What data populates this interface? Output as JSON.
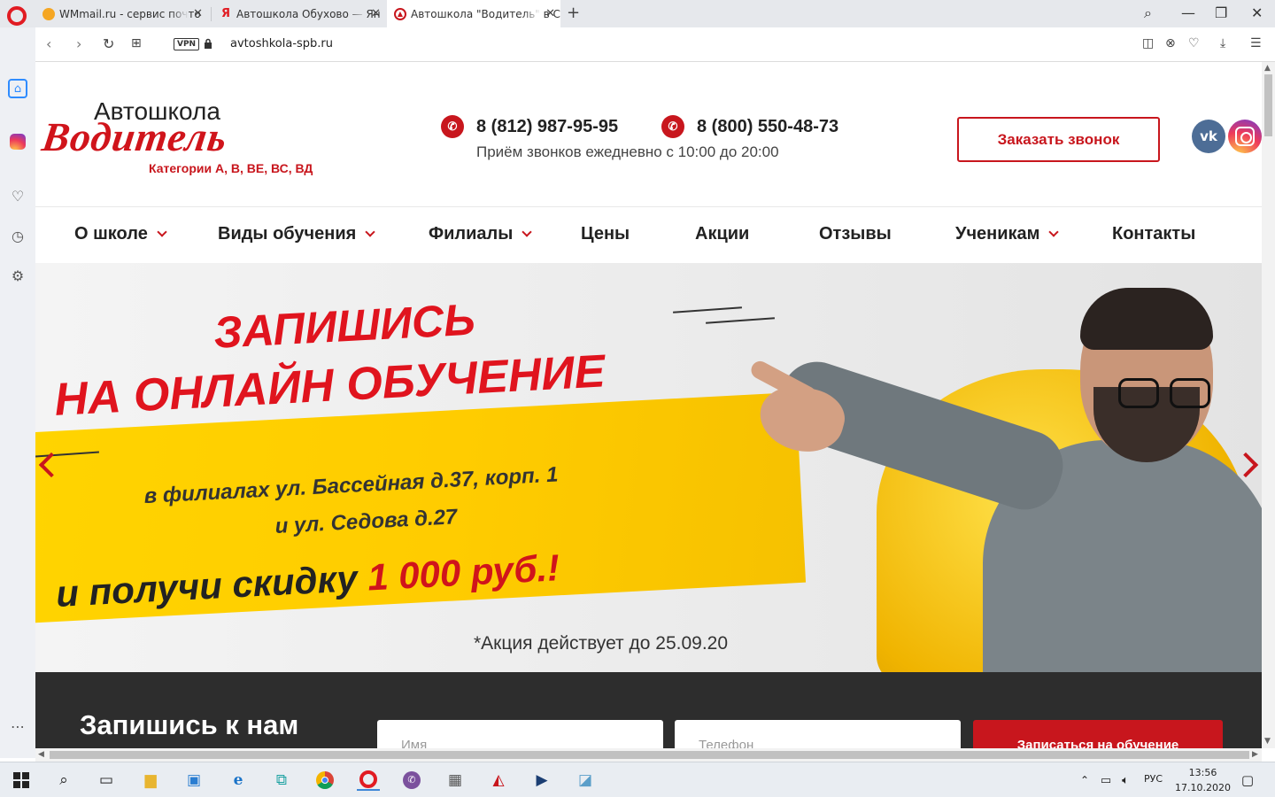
{
  "browser": {
    "tabs": [
      {
        "title": "WMmail.ru - сервис почто",
        "favicon_color": "#f5a623"
      },
      {
        "title": "Автошкола Обухово — Ян",
        "favicon_color": "#e11b22"
      },
      {
        "title": "Автошкола \"Водитель\" в С",
        "favicon_color": "#c8161d"
      }
    ],
    "vpn_label": "VPN",
    "url": "avtoshkola-spb.ru"
  },
  "header": {
    "logo_top": "Автошкола",
    "logo_main": "Водитель",
    "logo_sub": "Категории А, В, ВЕ, ВС, ВД",
    "phone1": "8 (812) 987-95-95",
    "phone2": "8 (800) 550-48-73",
    "hours": "Приём звонков ежедневно с 10:00 до 20:00",
    "callback_label": "Заказать звонок",
    "vk_label": "vk"
  },
  "menu": {
    "items": [
      {
        "label": "О школе",
        "dropdown": true
      },
      {
        "label": "Виды обучения",
        "dropdown": true
      },
      {
        "label": "Филиалы",
        "dropdown": true
      },
      {
        "label": "Цены",
        "dropdown": false
      },
      {
        "label": "Акции",
        "dropdown": false
      },
      {
        "label": "Отзывы",
        "dropdown": false
      },
      {
        "label": "Ученикам",
        "dropdown": true
      },
      {
        "label": "Контакты",
        "dropdown": false
      }
    ]
  },
  "banner": {
    "line1": "ЗАПИШИСЬ",
    "line2": "НА ОНЛАЙН ОБУЧЕНИЕ",
    "line3": "в филиалах ул. Бассейная д.37, корп. 1",
    "line4": "и ул. Седова д.27",
    "line5_prefix": "и получи скидку",
    "line5_highlight": "1 000 руб.!",
    "note": "*Акция действует до 25.09.20"
  },
  "signup": {
    "title": "Запишись к нам",
    "name_placeholder": "Имя",
    "phone_placeholder": "Телефон",
    "submit_label": "Записаться на обучение"
  },
  "taskbar": {
    "language": "РУС",
    "time": "13:56",
    "date": "17.10.2020"
  }
}
